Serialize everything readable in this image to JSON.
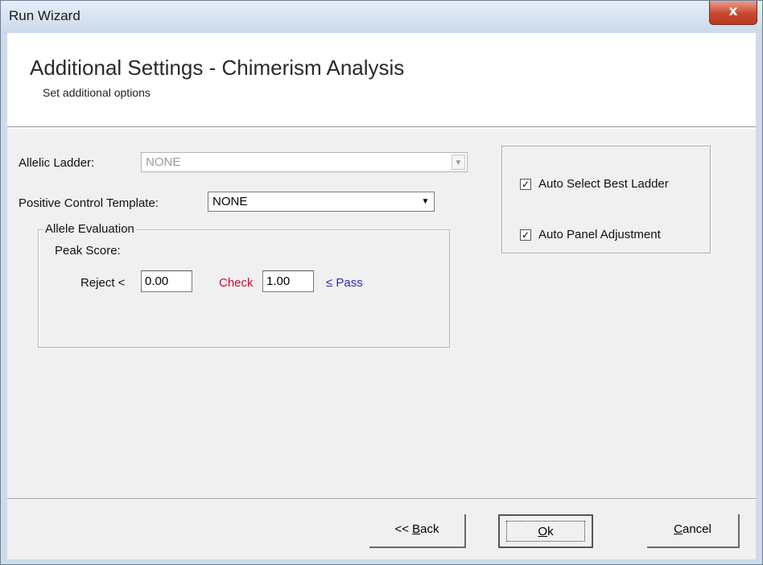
{
  "window": {
    "title": "Run Wizard",
    "close_label": "x"
  },
  "header": {
    "title": "Additional Settings - Chimerism Analysis",
    "subtitle": "Set additional options"
  },
  "allelic_ladder": {
    "label": "Allelic Ladder:",
    "value": "NONE",
    "enabled": false
  },
  "positive_control": {
    "label": "Positive Control Template:",
    "value": "NONE"
  },
  "allele_evaluation": {
    "legend": "Allele Evaluation",
    "peak_score_label": "Peak Score:",
    "reject_label": "Reject <",
    "reject_value": "0.00",
    "check_label": "Check",
    "check_value": "1.00",
    "pass_label": "≤ Pass",
    "colors": {
      "check": "#c8102e",
      "pass": "#2a2ab8"
    }
  },
  "options": {
    "auto_select_best_ladder": {
      "label": "Auto Select Best Ladder",
      "checked": true
    },
    "auto_panel_adjustment": {
      "label": "Auto Panel Adjustment",
      "checked": true
    }
  },
  "buttons": {
    "back": {
      "prefix": "<< ",
      "mnemonic": "B",
      "rest": "ack"
    },
    "ok": {
      "mnemonic": "O",
      "rest": "k"
    },
    "cancel": {
      "mnemonic": "C",
      "rest": "ancel"
    }
  },
  "icons": {
    "dropdown": "chevron-down-icon",
    "check": "checkmark-icon",
    "close": "close-icon"
  }
}
